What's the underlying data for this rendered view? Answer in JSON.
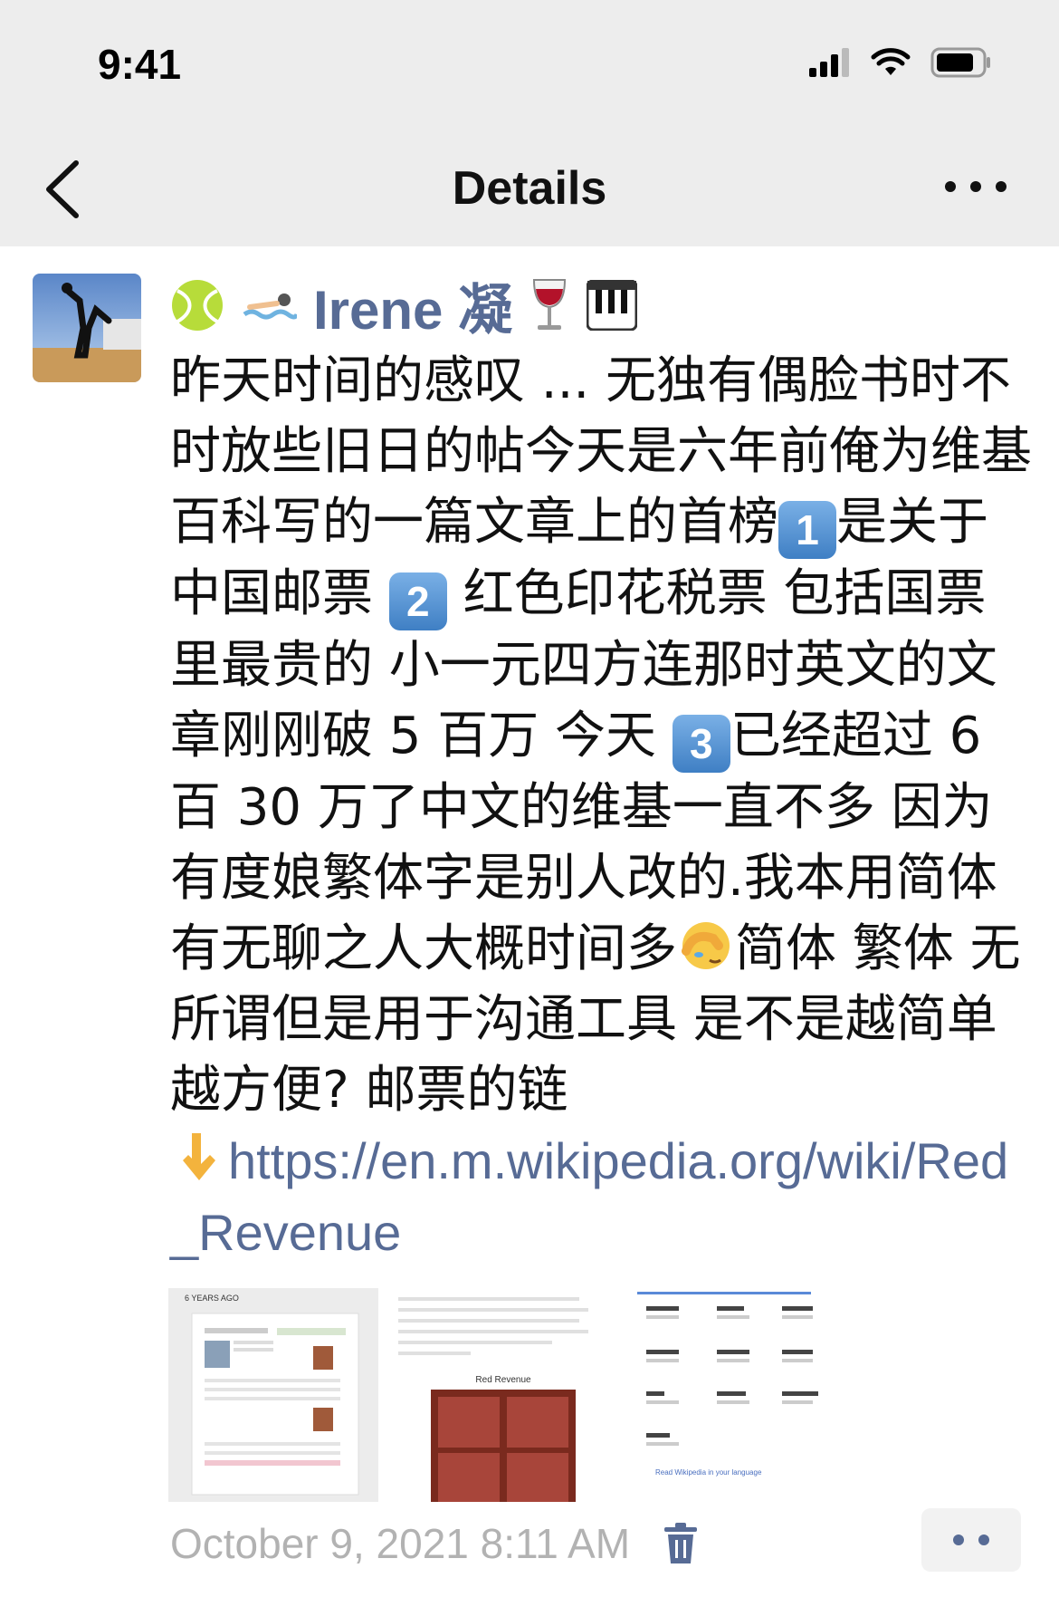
{
  "status_bar": {
    "time": "9:41"
  },
  "nav": {
    "title": "Details"
  },
  "post": {
    "author": "Irene 凝",
    "author_emojis": [
      "tennis-ball",
      "swimmer",
      "wine-glass",
      "piano"
    ],
    "text": {
      "p1": "昨天时间的感叹 ... 无独有偶脸书时不时放些旧日的帖今天是六年前俺为维基百科写的一篇文章上的首榜",
      "p2": "是关于中国邮票",
      "p3": "红色印花税票 包括国票里最贵的 小一元四方连那时英文的文章刚刚破 5 百万 今天",
      "p4": "已经超过 6 百 30 万了中文的维基一直不多 因为有度娘繁体字是别人改的.我本用简体 有无聊之人大概时间多",
      "p5": "简体 繁体 无所谓但是用于沟通工具 是不是越简单越方便? 邮票的链",
      "badge1": "1",
      "badge2": "2",
      "badge3": "3",
      "link": "https://en.m.wikipedia.org/wiki/Red_Revenue"
    },
    "thumbnails": [
      {
        "label": "6 YEARS AGO"
      },
      {
        "label": "Red Revenue"
      },
      {
        "label": "Read Wikipedia in your language"
      }
    ],
    "timestamp": "October 9, 2021 8:11 AM"
  },
  "colors": {
    "link": "#576b95",
    "nav_bg": "#ededed",
    "timestamp": "#b2b2b2"
  }
}
